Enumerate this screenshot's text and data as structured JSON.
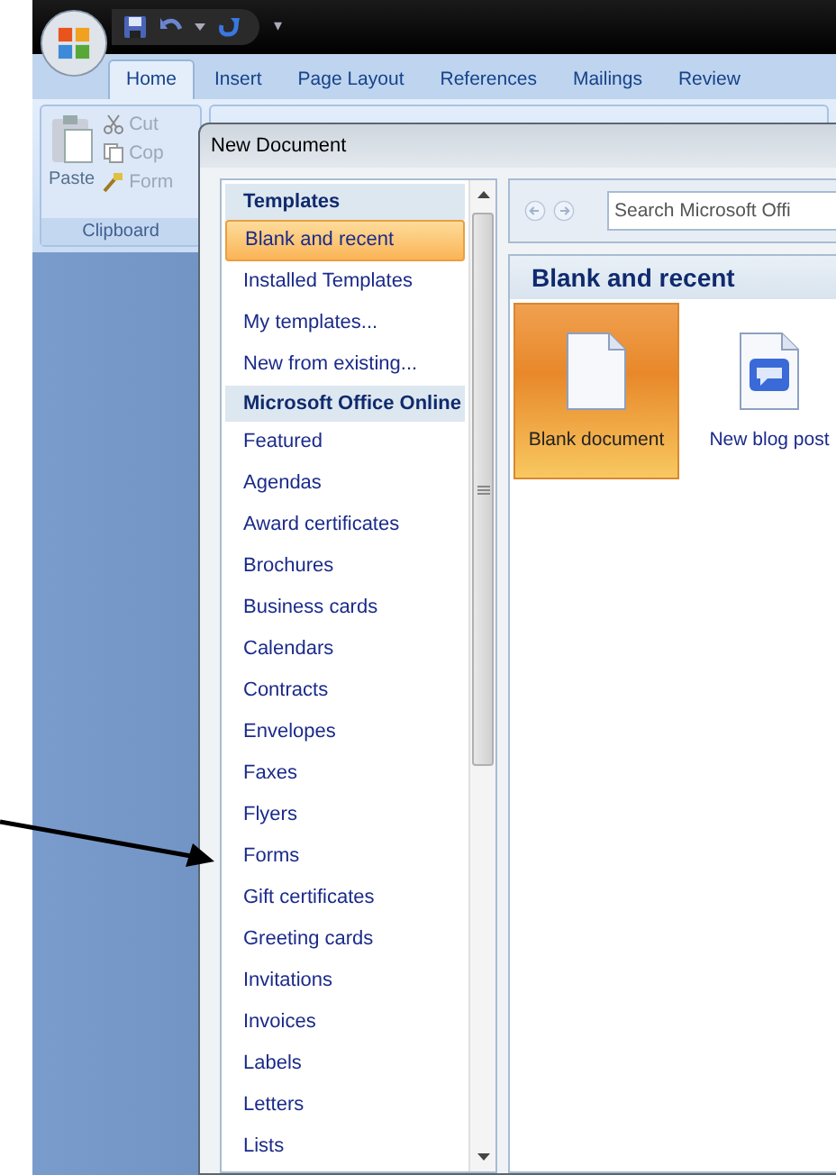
{
  "quick_access": {
    "customize": "▾"
  },
  "ribbon": {
    "tabs": [
      {
        "label": "Home",
        "selected": true
      },
      {
        "label": "Insert",
        "selected": false
      },
      {
        "label": "Page Layout",
        "selected": false
      },
      {
        "label": "References",
        "selected": false
      },
      {
        "label": "Mailings",
        "selected": false
      },
      {
        "label": "Review",
        "selected": false
      }
    ],
    "clipboard": {
      "paste": "Paste",
      "cut": "Cut",
      "copy": "Cop",
      "format": "Form",
      "group": "Clipboard"
    }
  },
  "dialog": {
    "title": "New Document",
    "templates": [
      {
        "kind": "header",
        "label": "Templates"
      },
      {
        "kind": "item",
        "label": "Blank and recent",
        "selected": true
      },
      {
        "kind": "item",
        "label": "Installed Templates",
        "selected": false
      },
      {
        "kind": "item",
        "label": "My templates...",
        "selected": false
      },
      {
        "kind": "item",
        "label": "New from existing...",
        "selected": false
      },
      {
        "kind": "header",
        "label": "Microsoft Office Online"
      },
      {
        "kind": "item",
        "label": "Featured",
        "selected": false
      },
      {
        "kind": "item",
        "label": "Agendas",
        "selected": false
      },
      {
        "kind": "item",
        "label": "Award certificates",
        "selected": false
      },
      {
        "kind": "item",
        "label": "Brochures",
        "selected": false
      },
      {
        "kind": "item",
        "label": "Business cards",
        "selected": false
      },
      {
        "kind": "item",
        "label": "Calendars",
        "selected": false
      },
      {
        "kind": "item",
        "label": "Contracts",
        "selected": false
      },
      {
        "kind": "item",
        "label": "Envelopes",
        "selected": false
      },
      {
        "kind": "item",
        "label": "Faxes",
        "selected": false
      },
      {
        "kind": "item",
        "label": "Flyers",
        "selected": false
      },
      {
        "kind": "item",
        "label": "Forms",
        "selected": false
      },
      {
        "kind": "item",
        "label": "Gift certificates",
        "selected": false
      },
      {
        "kind": "item",
        "label": "Greeting cards",
        "selected": false
      },
      {
        "kind": "item",
        "label": "Invitations",
        "selected": false
      },
      {
        "kind": "item",
        "label": "Invoices",
        "selected": false
      },
      {
        "kind": "item",
        "label": "Labels",
        "selected": false
      },
      {
        "kind": "item",
        "label": "Letters",
        "selected": false
      },
      {
        "kind": "item",
        "label": "Lists",
        "selected": false
      }
    ],
    "search": {
      "placeholder": "Search Microsoft Offi"
    },
    "section_title": "Blank and recent",
    "tiles": [
      {
        "kind": "blank",
        "label": "Blank document",
        "selected": true
      },
      {
        "kind": "blog",
        "label": "New blog post",
        "selected": false
      }
    ]
  }
}
